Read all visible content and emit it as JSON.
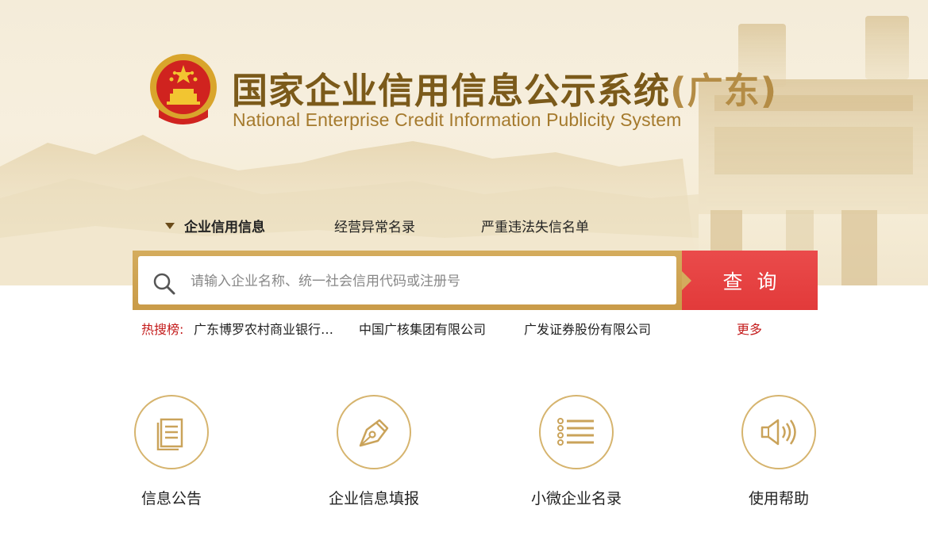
{
  "header": {
    "title_main": "国家企业信用信息公示系统",
    "title_region": "(广东)",
    "title_en": "National Enterprise Credit Information Publicity System",
    "emblem_icon": "national-emblem-icon"
  },
  "tabs": [
    {
      "label": "企业信用信息",
      "active": true
    },
    {
      "label": "经营异常名录",
      "active": false
    },
    {
      "label": "严重违法失信名单",
      "active": false
    }
  ],
  "search": {
    "placeholder": "请输入企业名称、统一社会信用代码或注册号",
    "value": "",
    "button_label": "查询",
    "icon": "search-icon"
  },
  "hot_search": {
    "label": "热搜榜:",
    "items": [
      "广东博罗农村商业银行…",
      "中国广核集团有限公司",
      "广发证券股份有限公司"
    ],
    "more_label": "更多"
  },
  "features": [
    {
      "label": "信息公告",
      "icon": "document-icon"
    },
    {
      "label": "企业信息填报",
      "icon": "pen-icon"
    },
    {
      "label": "小微企业名录",
      "icon": "list-icon"
    },
    {
      "label": "使用帮助",
      "icon": "speaker-icon"
    }
  ],
  "colors": {
    "gold": "#c99b48",
    "search_button": "#e8444a",
    "hot_label": "#c41c1c",
    "title_brown": "#7b5a1a"
  }
}
